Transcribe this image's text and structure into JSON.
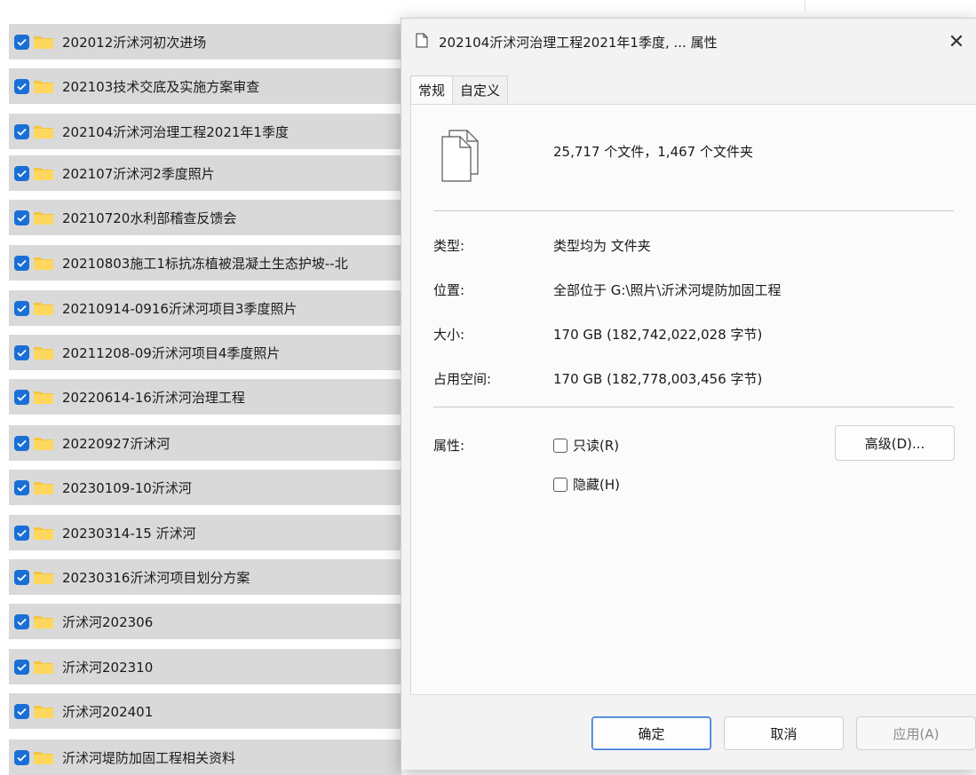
{
  "folders": [
    {
      "name": "202012沂沭河初次进场"
    },
    {
      "name": "202103技术交底及实施方案审查"
    },
    {
      "name": "202104沂沭河治理工程2021年1季度"
    },
    {
      "name": "202107沂沭河2季度照片"
    },
    {
      "name": "20210720水利部稽查反馈会"
    },
    {
      "name": "20210803施工1标抗冻植被混凝土生态护坡--北"
    },
    {
      "name": "20210914-0916沂沭河项目3季度照片"
    },
    {
      "name": "20211208-09沂沭河项目4季度照片"
    },
    {
      "name": "20220614-16沂沭河治理工程"
    },
    {
      "name": "20220927沂沭河"
    },
    {
      "name": "20230109-10沂沭河"
    },
    {
      "name": "20230314-15 沂沭河"
    },
    {
      "name": "20230316沂沭河项目划分方案"
    },
    {
      "name": "沂沭河202306"
    },
    {
      "name": "沂沭河202310"
    },
    {
      "name": "沂沭河202401"
    },
    {
      "name": "沂沭河堤防加固工程相关资料"
    }
  ],
  "dialog": {
    "title": "202104沂沭河治理工程2021年1季度, ... 属性",
    "close": "✕",
    "tabs": {
      "general": "常规",
      "custom": "自定义"
    },
    "summary": "25,717 个文件，1,467 个文件夹",
    "type_label": "类型:",
    "type_value": "类型均为 文件夹",
    "location_label": "位置:",
    "location_value": "全部位于 G:\\照片\\沂沭河堤防加固工程",
    "size_label": "大小:",
    "size_value": "170 GB (182,742,022,028 字节)",
    "disk_label": "占用空间:",
    "disk_value": "170 GB (182,778,003,456 字节)",
    "attr_label": "属性:",
    "readonly": "只读(R)",
    "hidden": "隐藏(H)",
    "advanced": "高级(D)...",
    "ok": "确定",
    "cancel": "取消",
    "apply": "应用(A)"
  },
  "colors": {
    "checkbox": "#1a6fd6",
    "folder": "#f4c542",
    "row_bg": "#d9d9d9"
  }
}
